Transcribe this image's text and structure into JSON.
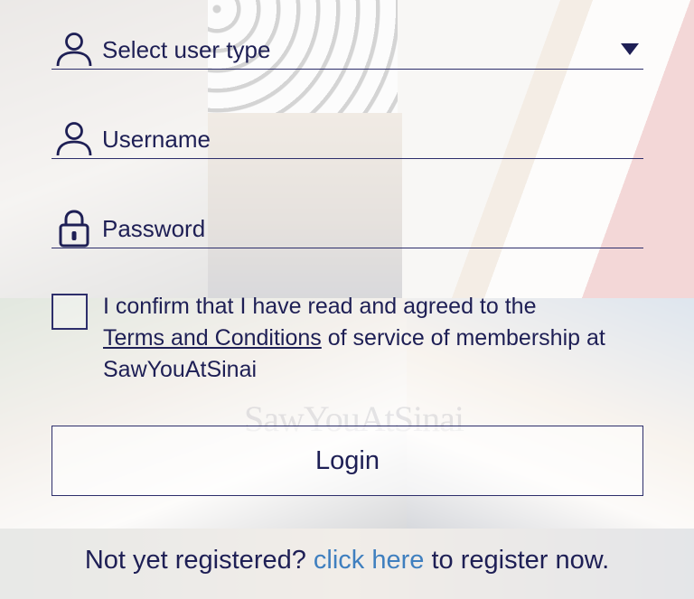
{
  "form": {
    "user_type_label": "Select user type",
    "username_placeholder": "Username",
    "password_placeholder": "Password"
  },
  "consent": {
    "prefix": "I confirm that I have read and agreed to the",
    "terms_link": "Terms and Conditions",
    "suffix": "of service of membership at SawYouAtSinai",
    "checked": false
  },
  "login_button": "Login",
  "register": {
    "prefix": "Not yet registered?",
    "link": "click here",
    "suffix": "to register now."
  },
  "watermark": "SawYouAtSinai",
  "colors": {
    "text": "#1e1f55",
    "link": "#3f7fbf",
    "border": "#2d2e6b"
  },
  "icons": {
    "user_type": "user-icon",
    "username": "user-icon",
    "password": "lock-icon",
    "dropdown": "caret-down-icon"
  }
}
